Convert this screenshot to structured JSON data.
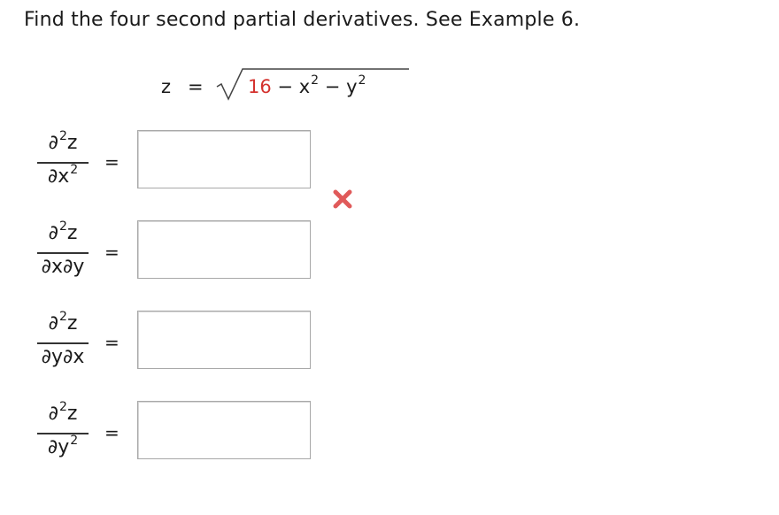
{
  "prompt": "Find the four second partial derivatives. See Example 6.",
  "equation": {
    "lhs": "z",
    "equals": "=",
    "constant": "16",
    "minus1": "−",
    "term1_var": "x",
    "term1_exp": "2",
    "minus2": "−",
    "term2_var": "y",
    "term2_exp": "2"
  },
  "rows": [
    {
      "num_base": "∂",
      "num_exp": "2",
      "num_var": "z",
      "den_base": "∂x",
      "den_exp": "2",
      "den_rest": "",
      "equals": "=",
      "answer_value": "",
      "marked_wrong": true
    },
    {
      "num_base": "∂",
      "num_exp": "2",
      "num_var": "z",
      "den_base": "∂x∂y",
      "den_exp": "",
      "den_rest": "",
      "equals": "=",
      "answer_value": "",
      "marked_wrong": false
    },
    {
      "num_base": "∂",
      "num_exp": "2",
      "num_var": "z",
      "den_base": "∂y∂x",
      "den_exp": "",
      "den_rest": "",
      "equals": "=",
      "answer_value": "",
      "marked_wrong": false
    },
    {
      "num_base": "∂",
      "num_exp": "2",
      "num_var": "z",
      "den_base": "∂y",
      "den_exp": "2",
      "den_rest": "",
      "equals": "=",
      "answer_value": "",
      "marked_wrong": false
    }
  ],
  "colors": {
    "highlight": "#d4322e",
    "wrong_mark": "#e05a5a",
    "input_border": "#a8a8a8"
  },
  "icons": {
    "wrong": "x-mark-icon",
    "radical": "square-root-icon"
  }
}
